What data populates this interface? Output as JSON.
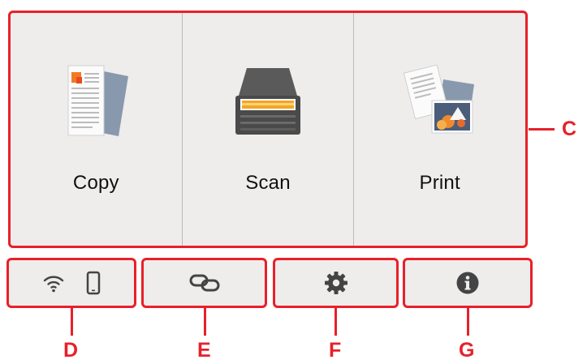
{
  "functions": [
    {
      "label": "Copy",
      "icon": "copy-icon"
    },
    {
      "label": "Scan",
      "icon": "scan-icon"
    },
    {
      "label": "Print",
      "icon": "print-icon"
    }
  ],
  "status_buttons": [
    {
      "icons": [
        "wifi-icon",
        "smartphone-icon"
      ]
    },
    {
      "icons": [
        "link-icon"
      ]
    },
    {
      "icons": [
        "gear-icon"
      ]
    },
    {
      "icons": [
        "info-icon"
      ]
    }
  ],
  "callouts": {
    "c": "C",
    "d": "D",
    "e": "E",
    "f": "F",
    "g": "G"
  },
  "colors": {
    "accent": "#e8202a",
    "panel_bg": "#efecec",
    "icon_dark": "#444444"
  }
}
